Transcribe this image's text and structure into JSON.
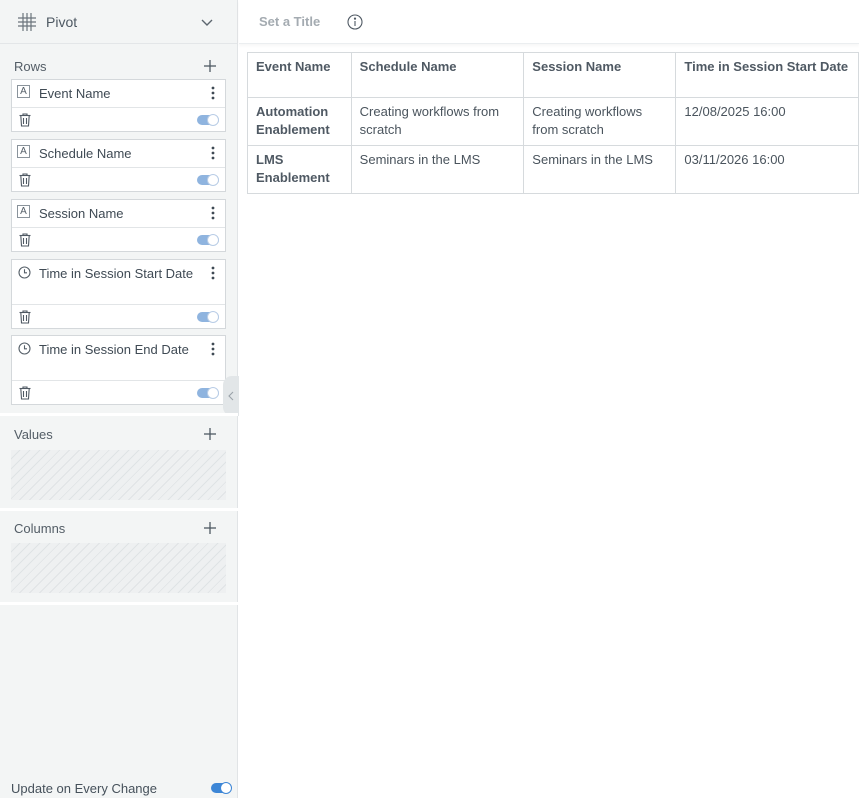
{
  "visualization": {
    "type_label": "Pivot",
    "type_icon": "grid-icon"
  },
  "title_bar": {
    "placeholder": "Set a Title",
    "info_icon": "info-icon"
  },
  "rows": {
    "label": "Rows",
    "fields": [
      {
        "name": "Event Name",
        "type": "text",
        "toggle_on": true
      },
      {
        "name": "Schedule Name",
        "type": "text",
        "toggle_on": true
      },
      {
        "name": "Session Name",
        "type": "text",
        "toggle_on": true
      },
      {
        "name": "Time in Session Start Date",
        "type": "datetime",
        "toggle_on": true
      },
      {
        "name": "Time in Session End Date",
        "type": "datetime",
        "toggle_on": true
      }
    ]
  },
  "values": {
    "label": "Values"
  },
  "columns": {
    "label": "Columns"
  },
  "footer": {
    "update_label": "Update on Every Change",
    "update_on": true
  },
  "table": {
    "headers": [
      "Event Name",
      "Schedule Name",
      "Session Name",
      "Time in Session Start Date"
    ],
    "rows": [
      [
        "Automation Enablement",
        "Creating workflows from scratch",
        "Creating workflows from scratch",
        "12/08/2025 16:00"
      ],
      [
        "LMS Enablement",
        "Seminars in the LMS",
        "Seminars in the LMS",
        "03/11/2026 16:00"
      ]
    ]
  },
  "colors": {
    "accent": "#3d86d6",
    "toggle_muted": "#8fb4df",
    "panel_bg": "#f3f5f5"
  }
}
